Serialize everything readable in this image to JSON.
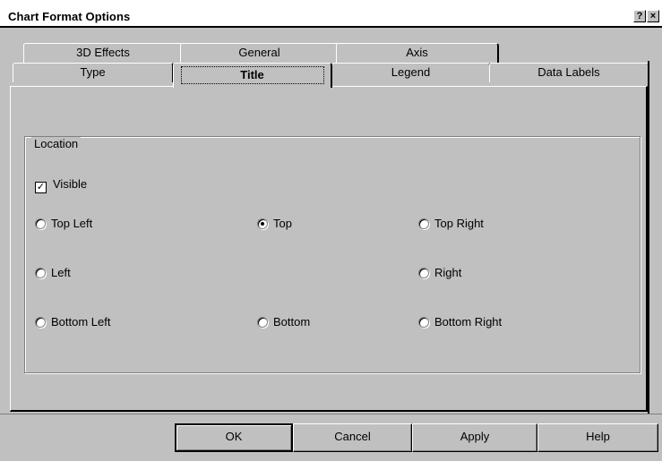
{
  "window": {
    "title": "Chart Format Options",
    "help_glyph": "?",
    "close_glyph": "×"
  },
  "tabs_back": [
    {
      "label": "3D Effects"
    },
    {
      "label": "General"
    },
    {
      "label": "Axis"
    }
  ],
  "tabs_front": [
    {
      "label": "Type"
    },
    {
      "label": "Title",
      "active": true
    },
    {
      "label": "Legend"
    },
    {
      "label": "Data Labels"
    }
  ],
  "location": {
    "group_label": "Location",
    "visible": {
      "label": "Visible",
      "checked": true,
      "mnemonic": "V"
    },
    "options": [
      {
        "label": "Top Left",
        "selected": false
      },
      {
        "label": "Top",
        "selected": true
      },
      {
        "label": "Top Right",
        "selected": false
      },
      {
        "label": "Left",
        "selected": false
      },
      {
        "label": "Right",
        "selected": false
      },
      {
        "label": "Bottom Left",
        "selected": false
      },
      {
        "label": "Bottom",
        "selected": false
      },
      {
        "label": "Bottom Right",
        "selected": false
      }
    ]
  },
  "buttons": {
    "ok": "OK",
    "cancel": "Cancel",
    "apply": "Apply",
    "help": "Help"
  }
}
